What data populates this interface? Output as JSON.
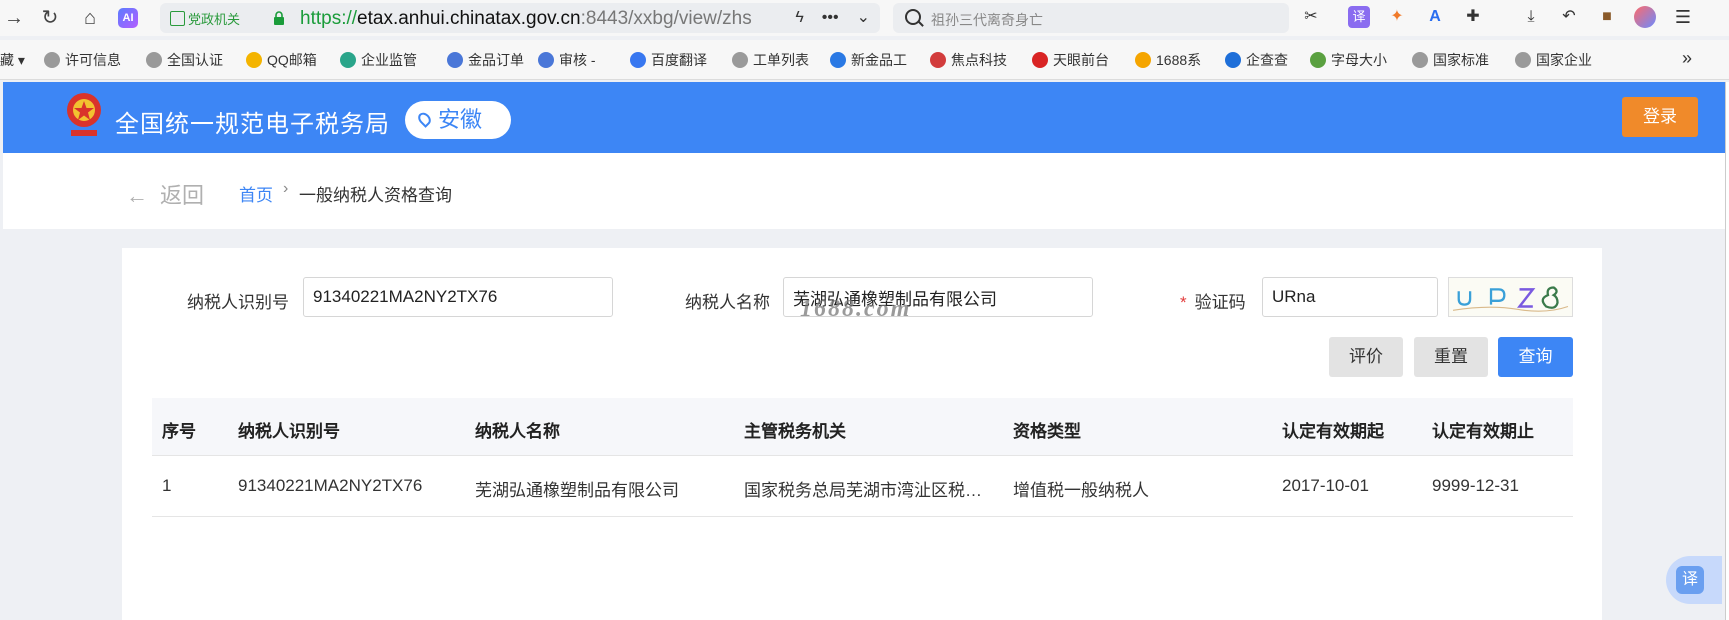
{
  "browser": {
    "gov_badge": "党政机关",
    "url_scheme": "https://",
    "url_domain": "etax.anhui.chinatax.gov.cn",
    "url_rest": ":8443/xxbg/view/zhs",
    "search_placeholder": "祖孙三代离奇身亡",
    "ai_label": "AI"
  },
  "bookmarks": [
    {
      "label": "藏",
      "color": "#f7f7f7"
    },
    {
      "label": "许可信息",
      "color": "#9a9a9a"
    },
    {
      "label": "全国认证",
      "color": "#9a9a9a"
    },
    {
      "label": "QQ邮箱",
      "color": "#f4b400"
    },
    {
      "label": "企业监管",
      "color": "#2aa58a"
    },
    {
      "label": "金品订单",
      "color": "#4a77d8"
    },
    {
      "label": "审核 -",
      "color": "#4a77d8"
    },
    {
      "label": "百度翻译",
      "color": "#3877f0"
    },
    {
      "label": "工单列表",
      "color": "#9a9a9a"
    },
    {
      "label": "新金品工",
      "color": "#2a79e4"
    },
    {
      "label": "焦点科技",
      "color": "#d23c3c"
    },
    {
      "label": "天眼前台",
      "color": "#d92424"
    },
    {
      "label": "1688系",
      "color": "#f5a500"
    },
    {
      "label": "企查查",
      "color": "#1e6fd9"
    },
    {
      "label": "字母大小",
      "color": "#5aa040"
    },
    {
      "label": "国家标准",
      "color": "#9a9a9a"
    },
    {
      "label": "国家企业",
      "color": "#9a9a9a"
    }
  ],
  "header": {
    "title": "全国统一规范电子税务局",
    "region": "安徽",
    "login_label": "登录"
  },
  "breadcrumb": {
    "back_label": "返回",
    "home_label": "首页",
    "separator": "›",
    "current_label": "一般纳税人资格查询"
  },
  "form": {
    "taxpayer_id_label": "纳税人识别号",
    "taxpayer_id_value": "91340221MA2NY2TX76",
    "taxpayer_name_label": "纳税人名称",
    "taxpayer_name_value": "芜湖弘通橡塑制品有限公司",
    "captcha_required_mark": "*",
    "captcha_label": "验证码",
    "captcha_value": "URna",
    "watermark": "1688.com"
  },
  "buttons": {
    "evaluate_label": "评价",
    "reset_label": "重置",
    "query_label": "查询"
  },
  "table": {
    "headers": [
      "序号",
      "纳税人识别号",
      "纳税人名称",
      "主管税务机关",
      "资格类型",
      "认定有效期起",
      "认定有效期止"
    ],
    "rows": [
      [
        "1",
        "91340221MA2NY2TX76",
        "芜湖弘通橡塑制品有限公司",
        "国家税务总局芜湖市湾沚区税…",
        "增值税一般纳税人",
        "2017-10-01",
        "9999-12-31"
      ]
    ]
  },
  "translate_fab": "译",
  "colors": {
    "header_blue": "#3d86f5",
    "login_orange": "#f08a2a",
    "secure_green": "#1a9c3a"
  }
}
